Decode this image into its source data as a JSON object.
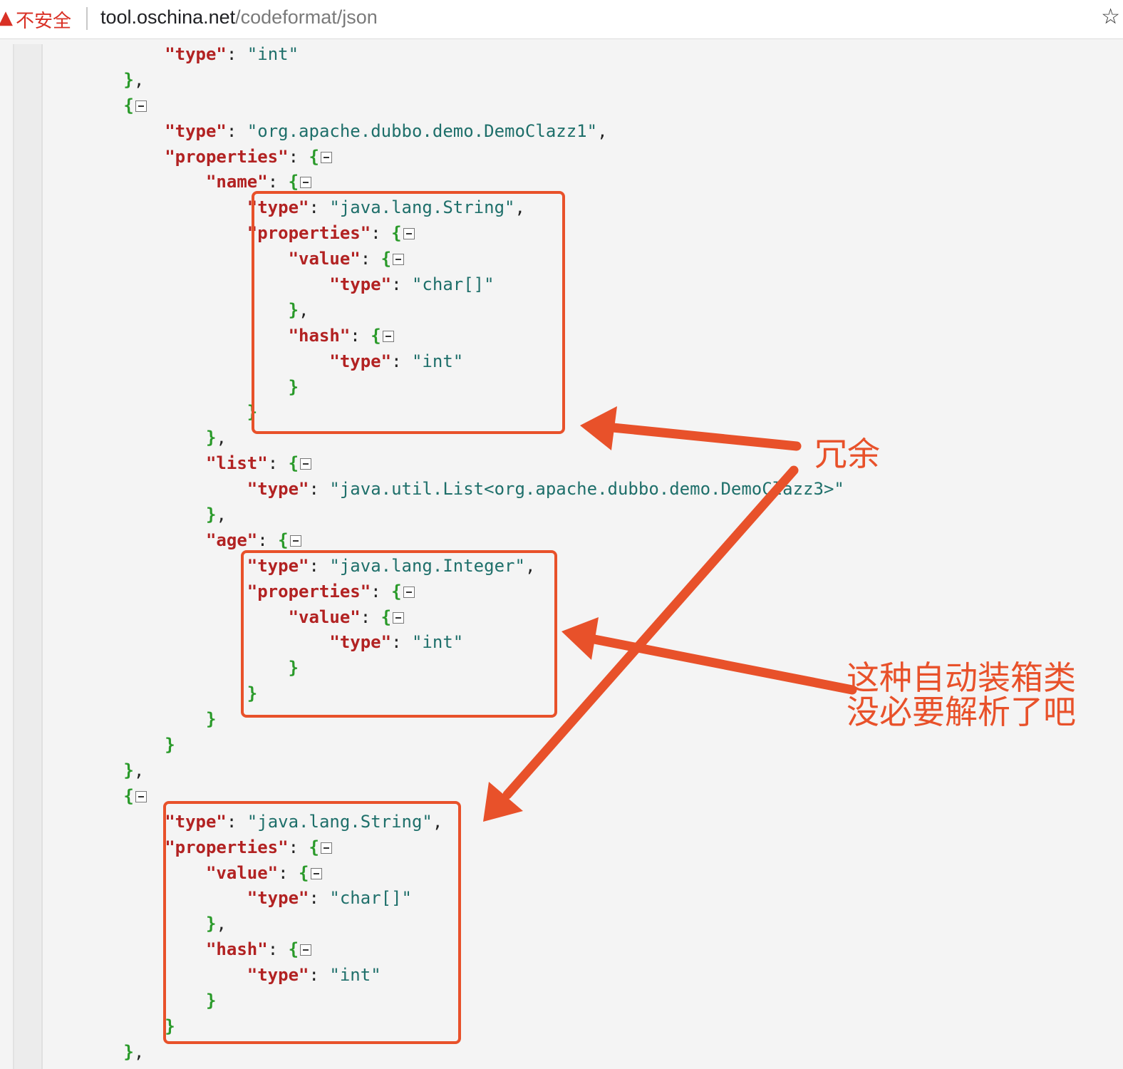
{
  "browser": {
    "security_text": "不安全",
    "url_host": "tool.oschina.net",
    "url_path": "/codeformat/json"
  },
  "annotations": {
    "redundant": "冗余",
    "autobox_line1": "这种自动装箱类",
    "autobox_line2": "没必要解析了吧"
  },
  "code_lines": [
    {
      "indent": 4,
      "key": "type",
      "value": "\"int\"",
      "tail": ""
    },
    {
      "indent": 3,
      "close": "}",
      "tail": ","
    },
    {
      "indent": 3,
      "open": "{",
      "fold": true
    },
    {
      "indent": 4,
      "key": "type",
      "value": "\"org.apache.dubbo.demo.DemoClazz1\"",
      "tail": ","
    },
    {
      "indent": 4,
      "key": "properties",
      "open": "{",
      "fold": true
    },
    {
      "indent": 5,
      "key": "name",
      "open": "{",
      "fold": true
    },
    {
      "indent": 6,
      "key": "type",
      "value": "\"java.lang.String\"",
      "tail": ","
    },
    {
      "indent": 6,
      "key": "properties",
      "open": "{",
      "fold": true
    },
    {
      "indent": 7,
      "key": "value",
      "open": "{",
      "fold": true
    },
    {
      "indent": 8,
      "key": "type",
      "value": "\"char[]\"",
      "tail": ""
    },
    {
      "indent": 7,
      "close": "}",
      "tail": ","
    },
    {
      "indent": 7,
      "key": "hash",
      "open": "{",
      "fold": true
    },
    {
      "indent": 8,
      "key": "type",
      "value": "\"int\"",
      "tail": ""
    },
    {
      "indent": 7,
      "close": "}",
      "tail": ""
    },
    {
      "indent": 6,
      "close": "}",
      "tail": ""
    },
    {
      "indent": 5,
      "close": "}",
      "tail": ","
    },
    {
      "indent": 5,
      "key": "list",
      "open": "{",
      "fold": true
    },
    {
      "indent": 6,
      "key": "type",
      "value": "\"java.util.List<org.apache.dubbo.demo.DemoClazz3>\"",
      "tail": ""
    },
    {
      "indent": 5,
      "close": "}",
      "tail": ","
    },
    {
      "indent": 5,
      "key": "age",
      "open": "{",
      "fold": true
    },
    {
      "indent": 6,
      "key": "type",
      "value": "\"java.lang.Integer\"",
      "tail": ","
    },
    {
      "indent": 6,
      "key": "properties",
      "open": "{",
      "fold": true
    },
    {
      "indent": 7,
      "key": "value",
      "open": "{",
      "fold": true
    },
    {
      "indent": 8,
      "key": "type",
      "value": "\"int\"",
      "tail": ""
    },
    {
      "indent": 7,
      "close": "}",
      "tail": ""
    },
    {
      "indent": 6,
      "close": "}",
      "tail": ""
    },
    {
      "indent": 5,
      "close": "}",
      "tail": ""
    },
    {
      "indent": 4,
      "close": "}",
      "tail": ""
    },
    {
      "indent": 3,
      "close": "}",
      "tail": ","
    },
    {
      "indent": 3,
      "open": "{",
      "fold": true
    },
    {
      "indent": 4,
      "key": "type",
      "value": "\"java.lang.String\"",
      "tail": ","
    },
    {
      "indent": 4,
      "key": "properties",
      "open": "{",
      "fold": true
    },
    {
      "indent": 5,
      "key": "value",
      "open": "{",
      "fold": true
    },
    {
      "indent": 6,
      "key": "type",
      "value": "\"char[]\"",
      "tail": ""
    },
    {
      "indent": 5,
      "close": "}",
      "tail": ","
    },
    {
      "indent": 5,
      "key": "hash",
      "open": "{",
      "fold": true
    },
    {
      "indent": 6,
      "key": "type",
      "value": "\"int\"",
      "tail": ""
    },
    {
      "indent": 5,
      "close": "}",
      "tail": ""
    },
    {
      "indent": 4,
      "close": "}",
      "tail": ""
    },
    {
      "indent": 3,
      "close": "}",
      "tail": ","
    }
  ],
  "colors": {
    "annotation": "#e8512a",
    "json_key": "#b22222",
    "json_string": "#1e6f6a",
    "json_brace": "#2a9a2a",
    "insecure_text": "#d93025"
  }
}
